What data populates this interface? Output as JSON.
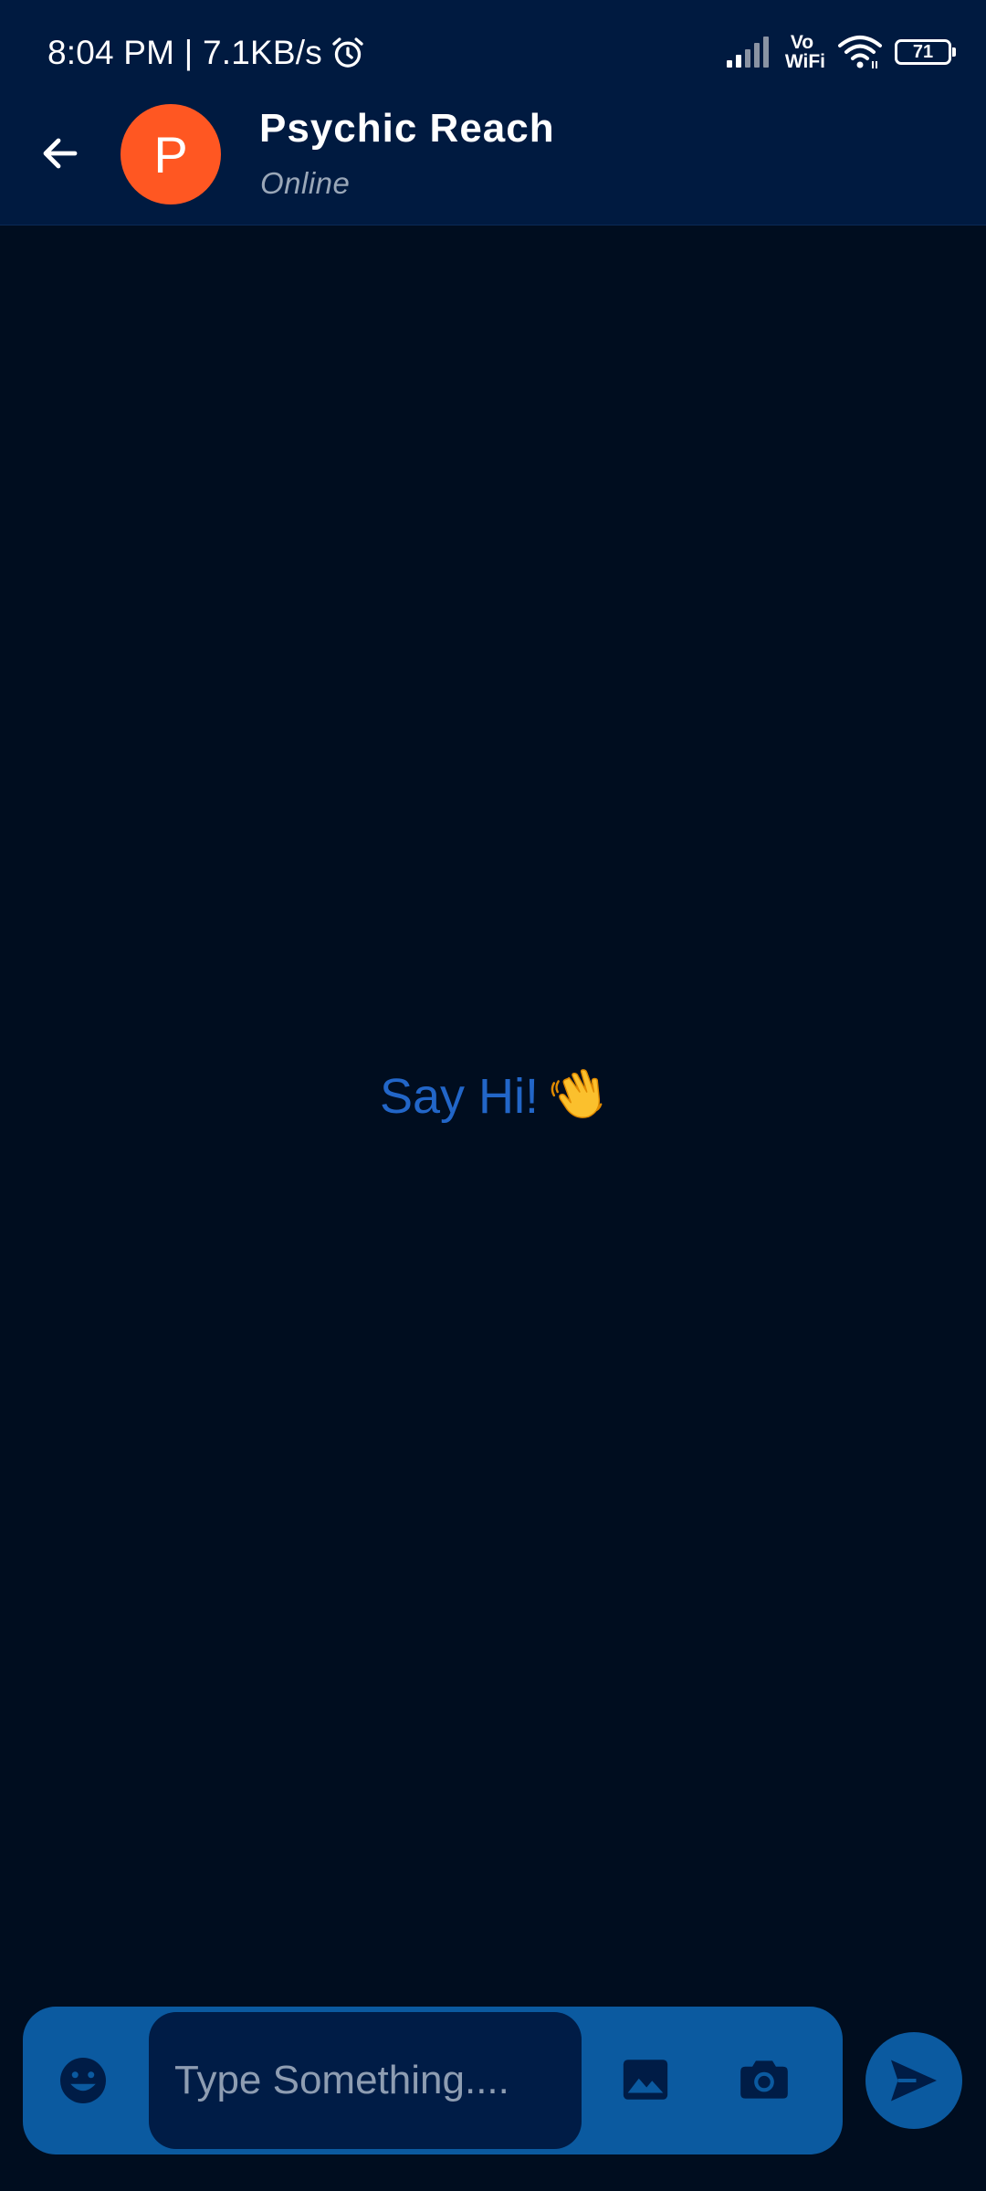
{
  "status_bar": {
    "time_speed": "8:04 PM | 7.1KB/s",
    "vowifi_top": "Vo",
    "vowifi_bottom": "WiFi",
    "battery_level": "71"
  },
  "header": {
    "avatar_letter": "P",
    "contact_name": "Psychic Reach",
    "contact_status": "Online"
  },
  "chat": {
    "empty_hint": "Say Hi!"
  },
  "composer": {
    "placeholder": "Type Something...."
  },
  "icons": {
    "back": "arrow-left-icon",
    "emoji": "emoji-icon",
    "gallery": "image-icon",
    "camera": "camera-icon",
    "send": "send-icon",
    "wave": "waving-hand-emoji"
  },
  "colors": {
    "app_bar": "#001a40",
    "background": "#000d1f",
    "avatar": "#ff5722",
    "accent": "#0b5aa0",
    "hint_text": "#2266c8",
    "input_field": "#001c46"
  }
}
